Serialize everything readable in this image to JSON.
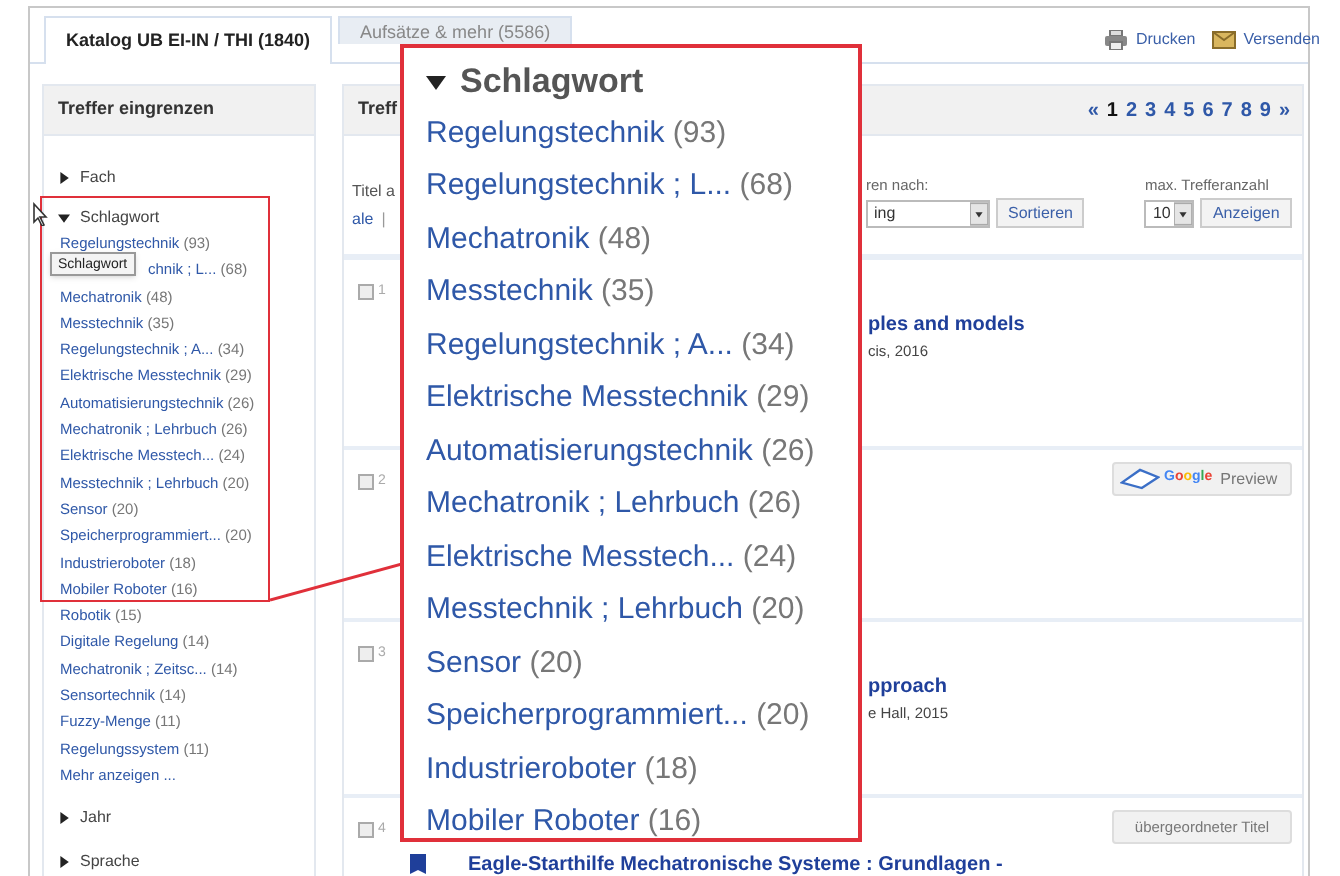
{
  "tabs": [
    {
      "label": "Katalog UB EI-IN / THI (1840)",
      "selected": true
    },
    {
      "label": "Aufsätze & mehr (5586)",
      "selected": false
    }
  ],
  "actions": [
    {
      "kind": "print",
      "label": "Drucken"
    },
    {
      "kind": "mail",
      "label": "Versenden"
    }
  ],
  "sidebar": {
    "title": "Treffer eingrenzen",
    "facets": [
      {
        "label": "Fach",
        "expanded": false
      },
      {
        "label": "Schlagwort",
        "expanded": true,
        "more": "Mehr anzeigen ...",
        "items": [
          {
            "label": "Regelungstechnik",
            "count": "(93)"
          },
          {
            "label": "chnik ; L...",
            "count": "(68)"
          },
          {
            "label": "Mechatronik",
            "count": "(48)"
          },
          {
            "label": "Messtechnik",
            "count": "(35)"
          },
          {
            "label": "Regelungstechnik ; A...",
            "count": "(34)"
          },
          {
            "label": "Elektrische Messtechnik",
            "count": "(29)"
          },
          {
            "label": "Automatisierungstechnik",
            "count": "(26)"
          },
          {
            "label": "Mechatronik ; Lehrbuch",
            "count": "(26)"
          },
          {
            "label": "Elektrische Messtech...",
            "count": "(24)"
          },
          {
            "label": "Messtechnik ; Lehrbuch",
            "count": "(20)"
          },
          {
            "label": "Sensor",
            "count": "(20)"
          },
          {
            "label": "Speicherprogrammiert...",
            "count": "(20)"
          },
          {
            "label": "Industrieroboter",
            "count": "(18)"
          },
          {
            "label": "Mobiler Roboter",
            "count": "(16)"
          },
          {
            "label": "Robotik",
            "count": "(15)"
          },
          {
            "label": "Digitale Regelung",
            "count": "(14)"
          },
          {
            "label": "Mechatronik ; Zeitsc...",
            "count": "(14)"
          },
          {
            "label": "Sensortechnik",
            "count": "(14)"
          },
          {
            "label": "Fuzzy-Menge",
            "count": "(11)"
          },
          {
            "label": "Regelungssystem",
            "count": "(11)"
          }
        ]
      },
      {
        "label": "Jahr",
        "expanded": false
      },
      {
        "label": "Sprache",
        "expanded": false
      }
    ]
  },
  "tooltip": "Schlagwort",
  "callout": {
    "title": "Schlagwort",
    "items": [
      {
        "label": "Regelungstechnik",
        "count": "(93)"
      },
      {
        "label": "Regelungstechnik ; L...",
        "count": "(68)"
      },
      {
        "label": "Mechatronik",
        "count": "(48)"
      },
      {
        "label": "Messtechnik",
        "count": "(35)"
      },
      {
        "label": "Regelungstechnik ; A...",
        "count": "(34)"
      },
      {
        "label": "Elektrische Messtechnik",
        "count": "(29)"
      },
      {
        "label": "Automatisierungstechnik",
        "count": "(26)"
      },
      {
        "label": "Mechatronik ; Lehrbuch",
        "count": "(26)"
      },
      {
        "label": "Elektrische Messtech...",
        "count": "(24)"
      },
      {
        "label": "Messtechnik ; Lehrbuch",
        "count": "(20)"
      },
      {
        "label": "Sensor",
        "count": "(20)"
      },
      {
        "label": "Speicherprogrammiert...",
        "count": "(20)"
      },
      {
        "label": "Industrieroboter",
        "count": "(18)"
      },
      {
        "label": "Mobiler Roboter",
        "count": "(16)"
      }
    ]
  },
  "results_header": {
    "title": "Treff",
    "prev": "«",
    "next": "»",
    "pages": [
      {
        "label": "1",
        "selected": true
      },
      {
        "label": "2",
        "selected": false
      },
      {
        "label": "3",
        "selected": false
      },
      {
        "label": "4",
        "selected": false
      },
      {
        "label": "5",
        "selected": false
      },
      {
        "label": "6",
        "selected": false
      },
      {
        "label": "7",
        "selected": false
      },
      {
        "label": "8",
        "selected": false
      },
      {
        "label": "9",
        "selected": false
      }
    ]
  },
  "controls": {
    "select_label": "Titel a",
    "link": "ale",
    "separator": "|",
    "sort_label": "ren nach:",
    "sort_value": "ing",
    "sort_button": "Sortieren",
    "max_label": "max. Trefferanzahl",
    "max_value": "10",
    "max_button": "Anzeigen"
  },
  "results": [
    {
      "number": "1",
      "checked": false,
      "title": "ples and models",
      "meta": "cis, 2016"
    },
    {
      "number": "2",
      "checked": false,
      "preview": {
        "logo": "Google",
        "label": "Preview"
      }
    },
    {
      "number": "3",
      "checked": false,
      "title": "pproach",
      "meta": "e Hall, 2015"
    },
    {
      "number": "4",
      "checked": false,
      "book": true,
      "title": "Eagle-Starthilfe Mechatronische Systeme : Grundlagen -",
      "button": "übergeordneter Titel"
    }
  ]
}
